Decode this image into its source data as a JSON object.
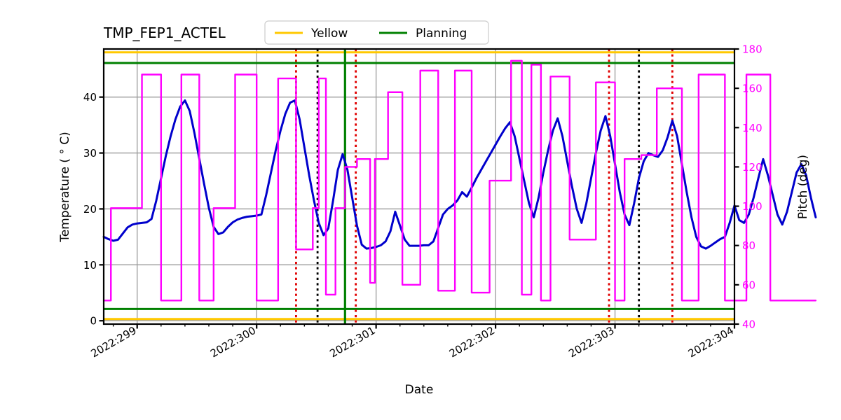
{
  "chart_data": {
    "type": "line",
    "title": "TMP_FEP1_ACTEL",
    "xlabel": "Date",
    "ylabel": "Temperature ( ° C)",
    "y2label": "Pitch (deg)",
    "xlim": [
      298.72,
      304.0
    ],
    "ylim": [
      -0.6,
      48.6
    ],
    "y2lim": [
      40,
      180
    ],
    "grid": true,
    "xticks": [
      "2022:299",
      "2022:300",
      "2022:301",
      "2022:302",
      "2022:303",
      "2022:304"
    ],
    "xtick_values": [
      299,
      300,
      301,
      302,
      303,
      304
    ],
    "xminor_step": 0.2,
    "yticks": [
      "0",
      "10",
      "20",
      "30",
      "40"
    ],
    "ytick_values": [
      0,
      10,
      20,
      30,
      40
    ],
    "y2ticks": [
      "40",
      "60",
      "80",
      "100",
      "120",
      "140",
      "160",
      "180"
    ],
    "y2tick_values": [
      40,
      60,
      80,
      100,
      120,
      140,
      160,
      180
    ],
    "legend": [
      {
        "label": "Yellow",
        "color": "#ffc800"
      },
      {
        "label": "Planning",
        "color": "#008000"
      }
    ],
    "legend_position": "upper center",
    "limit_lines": [
      {
        "name": "yellow-high",
        "color": "#ffc800",
        "value": 48.0
      },
      {
        "name": "planning-high",
        "color": "#008000",
        "value": 46.1
      },
      {
        "name": "planning-low",
        "color": "#008000",
        "value": 2.1
      },
      {
        "name": "yellow-low",
        "color": "#ffc800",
        "value": 0.3
      }
    ],
    "vertical_markers": [
      {
        "x": 300.33,
        "color": "#e00000",
        "style": "dotted"
      },
      {
        "x": 300.51,
        "color": "#000000",
        "style": "dotted"
      },
      {
        "x": 300.74,
        "color": "#008000",
        "style": "solid"
      },
      {
        "x": 300.83,
        "color": "#e00000",
        "style": "dotted"
      },
      {
        "x": 302.95,
        "color": "#e00000",
        "style": "dotted"
      },
      {
        "x": 303.2,
        "color": "#000000",
        "style": "dotted"
      },
      {
        "x": 303.48,
        "color": "#e00000",
        "style": "dotted"
      }
    ],
    "series": [
      {
        "name": "TMP_FEP1_ACTEL",
        "axis": "left",
        "color": "#0000cc",
        "unit": "°C",
        "points": [
          [
            298.72,
            15.0
          ],
          [
            298.76,
            14.6
          ],
          [
            298.8,
            14.3
          ],
          [
            298.84,
            14.5
          ],
          [
            298.88,
            15.6
          ],
          [
            298.92,
            16.7
          ],
          [
            298.96,
            17.2
          ],
          [
            299.0,
            17.4
          ],
          [
            299.04,
            17.5
          ],
          [
            299.08,
            17.6
          ],
          [
            299.12,
            18.2
          ],
          [
            299.16,
            21.5
          ],
          [
            299.2,
            25.5
          ],
          [
            299.24,
            29.5
          ],
          [
            299.28,
            33.0
          ],
          [
            299.32,
            36.0
          ],
          [
            299.36,
            38.3
          ],
          [
            299.4,
            39.4
          ],
          [
            299.44,
            37.5
          ],
          [
            299.48,
            33.5
          ],
          [
            299.52,
            29.0
          ],
          [
            299.56,
            24.5
          ],
          [
            299.6,
            20.2
          ],
          [
            299.64,
            16.8
          ],
          [
            299.68,
            15.5
          ],
          [
            299.72,
            15.8
          ],
          [
            299.76,
            16.8
          ],
          [
            299.8,
            17.6
          ],
          [
            299.84,
            18.1
          ],
          [
            299.88,
            18.4
          ],
          [
            299.92,
            18.6
          ],
          [
            299.96,
            18.7
          ],
          [
            300.0,
            18.8
          ],
          [
            300.04,
            19.0
          ],
          [
            300.08,
            22.5
          ],
          [
            300.12,
            26.5
          ],
          [
            300.16,
            30.5
          ],
          [
            300.2,
            34.0
          ],
          [
            300.24,
            37.0
          ],
          [
            300.28,
            39.0
          ],
          [
            300.32,
            39.4
          ],
          [
            300.36,
            36.0
          ],
          [
            300.4,
            31.0
          ],
          [
            300.44,
            26.0
          ],
          [
            300.48,
            21.5
          ],
          [
            300.52,
            17.5
          ],
          [
            300.56,
            15.3
          ],
          [
            300.6,
            16.5
          ],
          [
            300.64,
            21.5
          ],
          [
            300.68,
            27.0
          ],
          [
            300.72,
            29.8
          ],
          [
            300.76,
            27.0
          ],
          [
            300.8,
            22.0
          ],
          [
            300.84,
            17.0
          ],
          [
            300.88,
            13.6
          ],
          [
            300.92,
            12.9
          ],
          [
            300.96,
            13.0
          ],
          [
            301.0,
            13.2
          ],
          [
            301.04,
            13.5
          ],
          [
            301.08,
            14.2
          ],
          [
            301.12,
            16.0
          ],
          [
            301.16,
            19.5
          ],
          [
            301.2,
            17.0
          ],
          [
            301.24,
            14.5
          ],
          [
            301.28,
            13.4
          ],
          [
            301.32,
            13.4
          ],
          [
            301.36,
            13.4
          ],
          [
            301.4,
            13.5
          ],
          [
            301.44,
            13.5
          ],
          [
            301.48,
            14.2
          ],
          [
            301.52,
            16.6
          ],
          [
            301.56,
            19.0
          ],
          [
            301.6,
            20.0
          ],
          [
            301.64,
            20.6
          ],
          [
            301.68,
            21.5
          ],
          [
            301.72,
            23.0
          ],
          [
            301.76,
            22.2
          ],
          [
            301.8,
            23.8
          ],
          [
            301.84,
            25.5
          ],
          [
            301.88,
            27.0
          ],
          [
            301.92,
            28.5
          ],
          [
            301.96,
            30.0
          ],
          [
            302.0,
            31.5
          ],
          [
            302.04,
            33.0
          ],
          [
            302.08,
            34.4
          ],
          [
            302.12,
            35.5
          ],
          [
            302.16,
            33.0
          ],
          [
            302.2,
            29.0
          ],
          [
            302.24,
            25.0
          ],
          [
            302.28,
            21.0
          ],
          [
            302.32,
            18.5
          ],
          [
            302.36,
            22.0
          ],
          [
            302.4,
            26.5
          ],
          [
            302.44,
            30.5
          ],
          [
            302.48,
            34.0
          ],
          [
            302.52,
            36.2
          ],
          [
            302.56,
            33.0
          ],
          [
            302.6,
            28.5
          ],
          [
            302.64,
            24.0
          ],
          [
            302.68,
            20.0
          ],
          [
            302.72,
            17.5
          ],
          [
            302.76,
            21.0
          ],
          [
            302.8,
            25.5
          ],
          [
            302.84,
            30.0
          ],
          [
            302.88,
            34.0
          ],
          [
            302.92,
            36.6
          ],
          [
            302.96,
            33.0
          ],
          [
            303.0,
            28.0
          ],
          [
            303.04,
            23.0
          ],
          [
            303.08,
            19.0
          ],
          [
            303.12,
            17.1
          ],
          [
            303.16,
            21.0
          ],
          [
            303.2,
            25.5
          ],
          [
            303.24,
            28.5
          ],
          [
            303.28,
            30.0
          ],
          [
            303.32,
            29.6
          ],
          [
            303.36,
            29.3
          ],
          [
            303.4,
            30.5
          ],
          [
            303.44,
            32.8
          ],
          [
            303.48,
            35.8
          ],
          [
            303.52,
            33.0
          ],
          [
            303.56,
            28.0
          ],
          [
            303.6,
            23.0
          ],
          [
            303.64,
            18.5
          ],
          [
            303.68,
            15.0
          ],
          [
            303.72,
            13.3
          ],
          [
            303.76,
            12.9
          ],
          [
            303.8,
            13.4
          ],
          [
            303.84,
            14.0
          ],
          [
            303.88,
            14.6
          ],
          [
            303.92,
            15.0
          ],
          [
            303.96,
            17.5
          ],
          [
            304.0,
            20.6
          ],
          [
            304.04,
            18.0
          ],
          [
            304.08,
            17.5
          ],
          [
            304.12,
            19.0
          ],
          [
            304.16,
            22.0
          ],
          [
            304.2,
            25.5
          ],
          [
            304.24,
            28.9
          ],
          [
            304.28,
            26.0
          ],
          [
            304.32,
            22.5
          ],
          [
            304.36,
            19.0
          ],
          [
            304.4,
            17.2
          ],
          [
            304.44,
            19.5
          ],
          [
            304.48,
            23.0
          ],
          [
            304.52,
            26.5
          ],
          [
            304.56,
            28.0
          ],
          [
            304.6,
            26.0
          ],
          [
            304.64,
            22.0
          ],
          [
            304.68,
            18.5
          ]
        ]
      },
      {
        "name": "Pitch",
        "axis": "right",
        "color": "#ff00ff",
        "unit": "deg",
        "step": true,
        "points": [
          [
            298.72,
            52
          ],
          [
            298.78,
            52
          ],
          [
            298.78,
            99
          ],
          [
            299.04,
            99
          ],
          [
            299.04,
            167
          ],
          [
            299.2,
            167
          ],
          [
            299.2,
            52
          ],
          [
            299.37,
            52
          ],
          [
            299.37,
            167
          ],
          [
            299.52,
            167
          ],
          [
            299.52,
            52
          ],
          [
            299.64,
            52
          ],
          [
            299.64,
            99
          ],
          [
            299.82,
            99
          ],
          [
            299.82,
            167
          ],
          [
            300.0,
            167
          ],
          [
            300.0,
            52
          ],
          [
            300.18,
            52
          ],
          [
            300.18,
            165
          ],
          [
            300.33,
            165
          ],
          [
            300.33,
            78
          ],
          [
            300.47,
            78
          ],
          [
            300.47,
            99
          ],
          [
            300.52,
            99
          ],
          [
            300.52,
            165
          ],
          [
            300.58,
            165
          ],
          [
            300.58,
            55
          ],
          [
            300.66,
            55
          ],
          [
            300.66,
            99
          ],
          [
            300.74,
            99
          ],
          [
            300.74,
            120
          ],
          [
            300.84,
            120
          ],
          [
            300.84,
            124
          ],
          [
            300.95,
            124
          ],
          [
            300.95,
            61
          ],
          [
            300.99,
            61
          ],
          [
            300.99,
            124
          ],
          [
            301.04,
            124
          ],
          [
            301.04,
            124
          ],
          [
            301.1,
            124
          ],
          [
            301.1,
            158
          ],
          [
            301.22,
            158
          ],
          [
            301.22,
            60
          ],
          [
            301.37,
            60
          ],
          [
            301.37,
            169
          ],
          [
            301.52,
            169
          ],
          [
            301.52,
            57
          ],
          [
            301.66,
            57
          ],
          [
            301.66,
            169
          ],
          [
            301.8,
            169
          ],
          [
            301.8,
            56
          ],
          [
            301.95,
            56
          ],
          [
            301.95,
            113
          ],
          [
            302.13,
            113
          ],
          [
            302.13,
            174
          ],
          [
            302.22,
            174
          ],
          [
            302.22,
            55
          ],
          [
            302.3,
            55
          ],
          [
            302.3,
            172
          ],
          [
            302.38,
            172
          ],
          [
            302.38,
            52
          ],
          [
            302.46,
            52
          ],
          [
            302.46,
            166
          ],
          [
            302.55,
            166
          ],
          [
            302.55,
            166
          ],
          [
            302.62,
            166
          ],
          [
            302.62,
            83
          ],
          [
            302.76,
            83
          ],
          [
            302.76,
            83
          ],
          [
            302.84,
            83
          ],
          [
            302.84,
            163
          ],
          [
            302.94,
            163
          ],
          [
            302.94,
            163
          ],
          [
            303.0,
            163
          ],
          [
            303.0,
            52
          ],
          [
            303.08,
            52
          ],
          [
            303.08,
            124
          ],
          [
            303.22,
            124
          ],
          [
            303.22,
            126
          ],
          [
            303.35,
            126
          ],
          [
            303.35,
            160
          ],
          [
            303.48,
            160
          ],
          [
            303.48,
            160
          ],
          [
            303.56,
            160
          ],
          [
            303.56,
            52
          ],
          [
            303.7,
            52
          ],
          [
            303.7,
            167
          ],
          [
            303.92,
            167
          ],
          [
            303.92,
            52
          ],
          [
            304.0,
            52
          ],
          [
            304.0,
            52
          ],
          [
            304.1,
            52
          ],
          [
            304.1,
            167
          ],
          [
            304.3,
            167
          ],
          [
            304.3,
            52
          ],
          [
            304.68,
            52
          ]
        ]
      }
    ]
  }
}
